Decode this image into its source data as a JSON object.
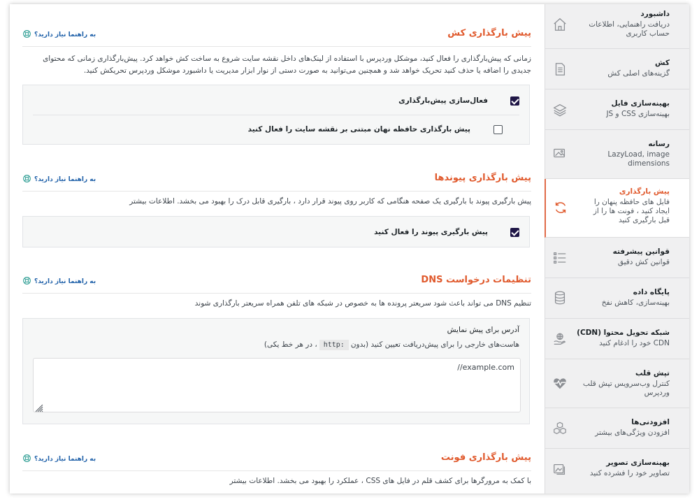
{
  "sidebar": {
    "items": [
      {
        "title": "داشبورد",
        "desc": "دریافت راهنمایی، اطلاعات حساب کاربری",
        "icon": "home-icon",
        "active": false
      },
      {
        "title": "کش",
        "desc": "گزینه‌های اصلی کش",
        "icon": "document-icon",
        "active": false
      },
      {
        "title": "بهینه‌سازی فایل",
        "desc": "بهینه‌سازی CSS و JS",
        "icon": "layers-icon",
        "active": false
      },
      {
        "title": "رسانه",
        "desc": "LazyLoad, image dimensions",
        "icon": "image-icon",
        "active": false
      },
      {
        "title": "پیش بارگذاری",
        "desc": "فایل های حافظه پنهان را ایجاد کنید ، فونت ها را از قبل بارگیری کنید",
        "icon": "refresh-icon",
        "active": true
      },
      {
        "title": "قوانین پیشرفته",
        "desc": "قوانین کش دقیق",
        "icon": "list-icon",
        "active": false
      },
      {
        "title": "پایگاه داده",
        "desc": "بهینه‌سازی، کاهش نفخ",
        "icon": "database-icon",
        "active": false
      },
      {
        "title": "شبکه تحویل محتوا (CDN)",
        "desc": "CDN خود را ادغام کنید",
        "icon": "cdn-hand-icon",
        "active": false
      },
      {
        "title": "تپش قلب",
        "desc": "کنترل وب‌سرویس تپش قلب وردپرس",
        "icon": "heartbeat-icon",
        "active": false
      },
      {
        "title": "افزودنی‌ها",
        "desc": "افزودن ویژگی‌های بیشتر",
        "icon": "cubes-icon",
        "active": false
      },
      {
        "title": "بهینه‌سازی تصویر",
        "desc": "تصاویر خود را فشرده کنید",
        "icon": "image-optimize-icon",
        "active": false
      }
    ]
  },
  "help_link_label": "به راهنما نیاز دارید؟",
  "sections": {
    "cache_preload": {
      "title": "پیش بارگذاری کش",
      "desc": "زمانی که پیش‌بارگذاری را فعال کنید، موشکل وردپرس با استفاده از لینک‌های داخل نقشه سایت شروع به ساخت کش خواهد کرد. پیش‌بارگذاری زمانی که محتوای جدیدی را اضافه یا حذف کنید تحریک خواهد شد و همچنین می‌توانید به صورت دستی از نوار ابزار مدیریت یا داشبورد موشکل وردپرس تحریکش کنید.",
      "options": [
        {
          "label": "فعال‌سازی پیش‌بارگذاری",
          "checked": true
        },
        {
          "label": "پیش بارگذاری حافظه نهان مبتنی بر نقشه سایت را فعال کنید",
          "checked": false
        }
      ]
    },
    "link_preload": {
      "title": "پیش بارگذاری پیوندها",
      "desc": "پیش بارگیری پیوند با بارگیری یک صفحه هنگامی که کاربر روی پیوند قرار دارد ، بارگیری قابل درک را بهبود می بخشد. اطلاعات بیشتر",
      "options": [
        {
          "label": "پیش بارگیری پیوند را فعال کنید",
          "checked": true
        }
      ]
    },
    "dns": {
      "title": "تنظیمات درخواست DNS",
      "desc": "تنظیم DNS می تواند باعث شود سریعتر پرونده ها به خصوص در شبکه های تلفن همراه سریعتر بارگذاری شوند",
      "field_label": "آدرس برای پیش نمایش",
      "field_hint_before": "هاست‌های خارجی را برای پیش‌دریافت تعیین کنید (بدون",
      "field_hint_code": "http:",
      "field_hint_after": "، در هر خط یکی)",
      "textarea_value": "//example.com"
    },
    "font_preload": {
      "title": "پیش بارگذاری فونت",
      "desc": "با کمک به مرورگرها برای کشف قلم در فایل های CSS ، عملکرد را بهبود می بخشد. اطلاعات بیشتر"
    }
  },
  "colors": {
    "accent": "#e0592c",
    "link": "#1d5fa8",
    "checkbox": "#1f1646"
  }
}
